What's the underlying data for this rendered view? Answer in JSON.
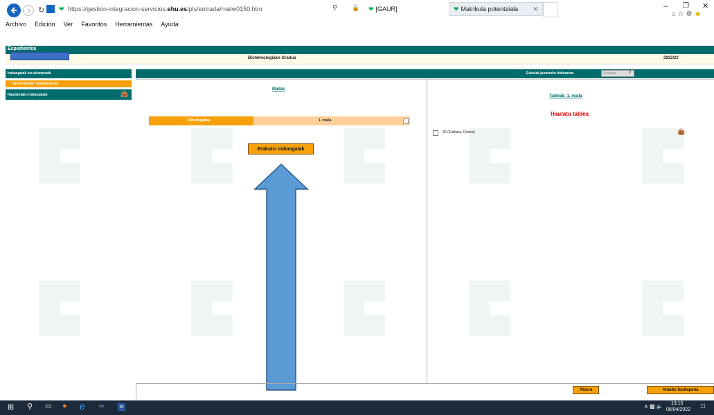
{
  "browser": {
    "url_prefix": "https://gestion-integracion-servicios.",
    "url_domain": "ehu.es",
    "url_path": "/pls/entrada/matw0150.htm",
    "tabs": [
      {
        "label": "[GAUR]"
      },
      {
        "label": "Matrikula potentziala"
      }
    ],
    "menu": [
      "Archivo",
      "Edición",
      "Ver",
      "Favoritos",
      "Herramientas",
      "Ayuda"
    ]
  },
  "header": {
    "section_title": "Espedientea",
    "degree": "Bioteknologiako Gradua",
    "year": "2022/23"
  },
  "sidebar": {
    "items": [
      {
        "label": "Irakasgaiak eta aitorpenak"
      },
      {
        "label": "Oinarrizkoak / Nahitaezkoak"
      },
      {
        "label": "Hautatutako irakasgaiak"
      }
    ]
  },
  "lang_bar": {
    "label": "Eskolak jasotzeko hizkuntza:",
    "selected": "Euskara"
  },
  "left_panel": {
    "title": "Mailak",
    "row": {
      "col1": "Zehaztugabea",
      "col2": "1. maila"
    },
    "show_button": "Erakutsi irakasgaiak"
  },
  "right_panel": {
    "title": "Taldeak: 1. maila",
    "prompt": "Hautatu taldea",
    "group_label": "32 (Euskara, Goizez)"
  },
  "footer": {
    "back_button": "Atzera",
    "finish_button": "Amaitu hautapena"
  },
  "taskbar": {
    "time": "13:15",
    "date": "08/04/2022"
  },
  "colors": {
    "teal": "#006c6c",
    "orange": "#f7a10a",
    "peach": "#ffd09a",
    "arrow": "#5b9bd5",
    "red": "#e00000"
  }
}
